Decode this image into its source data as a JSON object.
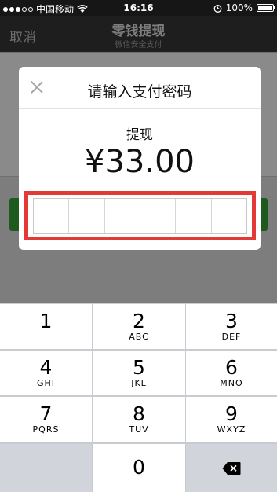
{
  "status_bar": {
    "carrier": "中国移动",
    "time": "16:16",
    "battery": "100%"
  },
  "navbar": {
    "cancel": "取消",
    "title": "零钱提现",
    "subtitle": "微信安全支付"
  },
  "dialog": {
    "title": "请输入支付密码",
    "label": "提现",
    "amount": "¥33.00",
    "password_cells": 6
  },
  "keypad": {
    "keys": [
      {
        "num": "1",
        "letters": ""
      },
      {
        "num": "2",
        "letters": "ABC"
      },
      {
        "num": "3",
        "letters": "DEF"
      },
      {
        "num": "4",
        "letters": "GHI"
      },
      {
        "num": "5",
        "letters": "JKL"
      },
      {
        "num": "6",
        "letters": "MNO"
      },
      {
        "num": "7",
        "letters": "PQRS"
      },
      {
        "num": "8",
        "letters": "TUV"
      },
      {
        "num": "9",
        "letters": "WXYZ"
      }
    ],
    "zero": "0"
  },
  "icons": [
    "signal-dots-icon",
    "wifi-icon",
    "alarm-icon",
    "battery-icon",
    "close-icon",
    "backspace-icon"
  ],
  "colors": {
    "highlight": "#e53935",
    "overlay": "#7d7d7d",
    "keypad_bg": "#c8cbd0"
  }
}
